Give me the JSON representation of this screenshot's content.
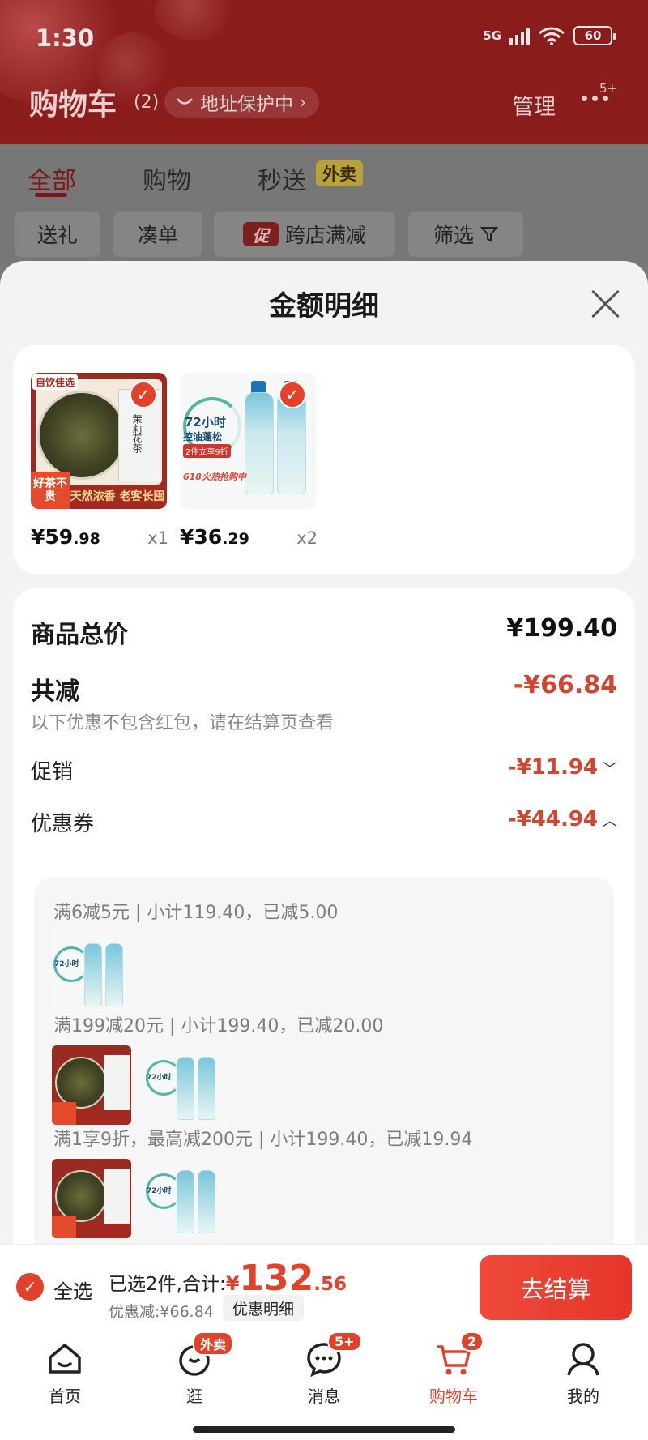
{
  "status_bar": {
    "time": "1:30",
    "network": "5G",
    "wifi_extra": "6",
    "battery": "60"
  },
  "header": {
    "title": "购物车",
    "count": "(2)",
    "address": "地址保护中",
    "manage": "管理",
    "more_badge": "5+"
  },
  "tabs": [
    {
      "label": "全部"
    },
    {
      "label": "购物"
    },
    {
      "label": "秒送"
    }
  ],
  "tab_waimai_badge": "外卖",
  "filters": {
    "gift": "送礼",
    "bundle": "凑单",
    "promo_tag": "促",
    "cross_store": "跨店满减",
    "filter": "筛选"
  },
  "sheet": {
    "title": "金额明细",
    "products": [
      {
        "name": "tea",
        "price_int": "¥59",
        "price_dec": ".98",
        "qty": "x1",
        "img_tag": "自饮佳选",
        "img_bottom": "天然浓香 老客长囤",
        "img_corner": "好茶不贵",
        "img_box": "茉莉花茶"
      },
      {
        "name": "shampoo",
        "price_int": "¥36",
        "price_dec": ".29",
        "qty": "x2",
        "img_title": "72小时",
        "img_sub": "控油蓬松",
        "img_offer": "2件立享9折",
        "img_promo": "618火热抢购中"
      }
    ],
    "total_label": "商品总价",
    "total_value": "¥199.40",
    "reduce_label": "共减",
    "reduce_value": "-¥66.84",
    "reduce_note": "以下优惠不包含红包，请在结算页查看",
    "promo_label": "促销",
    "promo_value": "-¥11.94",
    "coupon_label": "优惠券",
    "coupon_value": "-¥44.94",
    "coupon_lines": [
      "满6减5元 | 小计119.40，已减5.00",
      "满199减20元 | 小计199.40，已减20.00",
      "满1享9折，最高减200元 | 小计199.40，已减19.94"
    ]
  },
  "checkout": {
    "select_all": "全选",
    "summary_prefix": "已选2件,合计:",
    "currency": "¥",
    "total_int": "132",
    "total_dec": ".56",
    "discount_text": "优惠减:¥66.84",
    "discount_detail_btn": "优惠明细",
    "go_btn": "去结算"
  },
  "tabbar": [
    {
      "label": "首页",
      "badge": ""
    },
    {
      "label": "逛",
      "badge": "外卖"
    },
    {
      "label": "消息",
      "badge": "5+"
    },
    {
      "label": "购物车",
      "badge": "2"
    },
    {
      "label": "我的",
      "badge": ""
    }
  ],
  "colors": {
    "accent": "#e2412a",
    "header_bg": "#8b1c1c",
    "sheet_bg": "#f3f3f3"
  }
}
